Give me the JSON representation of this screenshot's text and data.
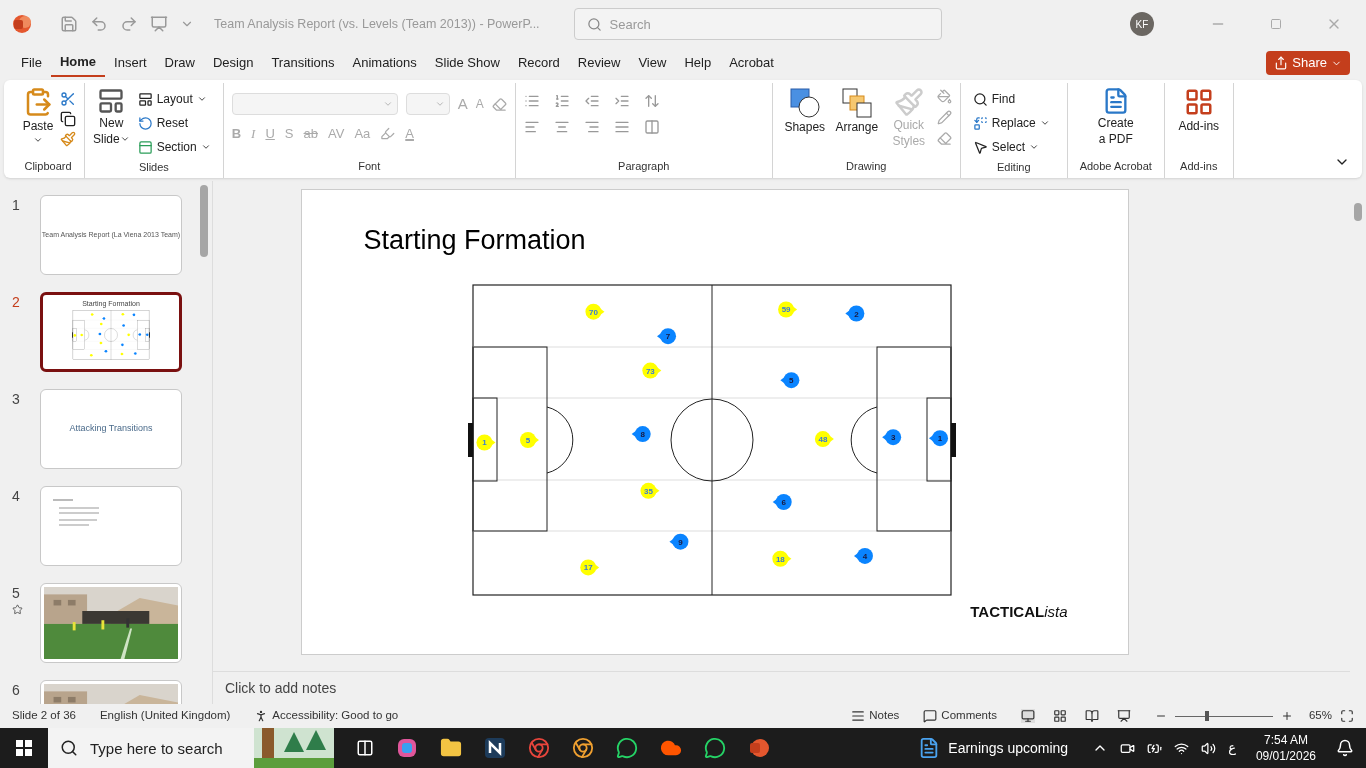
{
  "title_bar": {
    "title": "Team Analysis Report (vs. Levels (Team 2013))  -  PowerP...",
    "search_placeholder": "Search",
    "avatar": "KF"
  },
  "tabs": [
    {
      "label": "File",
      "selected": false
    },
    {
      "label": "Home",
      "selected": true
    },
    {
      "label": "Insert",
      "selected": false
    },
    {
      "label": "Draw",
      "selected": false
    },
    {
      "label": "Design",
      "selected": false
    },
    {
      "label": "Transitions",
      "selected": false
    },
    {
      "label": "Animations",
      "selected": false
    },
    {
      "label": "Slide Show",
      "selected": false
    },
    {
      "label": "Record",
      "selected": false
    },
    {
      "label": "Review",
      "selected": false
    },
    {
      "label": "View",
      "selected": false
    },
    {
      "label": "Help",
      "selected": false
    },
    {
      "label": "Acrobat",
      "selected": false
    }
  ],
  "share": "Share",
  "ribbon": {
    "clipboard": {
      "label": "Clipboard",
      "paste": "Paste"
    },
    "slides": {
      "label": "Slides",
      "new_slide": [
        "New",
        "Slide"
      ],
      "items": [
        "Layout",
        "Reset",
        "Section"
      ]
    },
    "font": {
      "label": "Font",
      "grow": "A",
      "shrink": "A",
      "buttons": [
        "B",
        "I",
        "U",
        "S",
        "ab",
        "AV",
        "Aa"
      ],
      "font_color_button": "A"
    },
    "paragraph": {
      "label": "Paragraph"
    },
    "drawing": {
      "label": "Drawing",
      "items": [
        {
          "label": "Shapes",
          "disabled": false
        },
        {
          "label": "Arrange",
          "disabled": false
        },
        {
          "label": "Quick Styles",
          "disabled": true
        }
      ]
    },
    "editing": {
      "label": "Editing",
      "items": [
        "Find",
        "Replace",
        "Select"
      ]
    },
    "acrobat": {
      "label": "Adobe Acrobat",
      "button": [
        "Create",
        "a PDF"
      ]
    },
    "addins": {
      "label": "Add-ins",
      "button": "Add-ins"
    }
  },
  "thumbnails": [
    {
      "number": "1",
      "selected": false,
      "starred": false,
      "kind": "title",
      "title": "Team Analysis Report (La Viena 2013 Team)"
    },
    {
      "number": "2",
      "selected": true,
      "starred": false,
      "kind": "formation",
      "title": "Starting Formation"
    },
    {
      "number": "3",
      "selected": false,
      "starred": false,
      "kind": "section",
      "title": "Attacking Transitions"
    },
    {
      "number": "4",
      "selected": false,
      "starred": false,
      "kind": "bullets"
    },
    {
      "number": "5",
      "selected": false,
      "starred": true,
      "kind": "picture"
    },
    {
      "number": "6",
      "selected": false,
      "starred": false,
      "kind": "picture"
    }
  ],
  "slide": {
    "title": "Starting Formation",
    "logo": {
      "main": "TACTICAL",
      "accent": "ista"
    },
    "players": [
      {
        "number": "70",
        "color": "#ffff00"
      },
      {
        "number": "73",
        "color": "#ffff00"
      },
      {
        "number": "1",
        "color": "#ffff00"
      },
      {
        "number": "5",
        "color": "#ffff00"
      },
      {
        "number": "35",
        "color": "#ffff00"
      },
      {
        "number": "17",
        "color": "#ffff00"
      },
      {
        "number": "59",
        "color": "#ffff00"
      },
      {
        "number": "48",
        "color": "#ffff00"
      },
      {
        "number": "18",
        "color": "#ffff00"
      },
      {
        "number": "7",
        "color": "#0a84ff"
      },
      {
        "number": "8",
        "color": "#0a84ff"
      },
      {
        "number": "9",
        "color": "#0a84ff"
      },
      {
        "number": "2",
        "color": "#0a84ff"
      },
      {
        "number": "5",
        "color": "#0a84ff"
      },
      {
        "number": "6",
        "color": "#0a84ff"
      },
      {
        "number": "3",
        "color": "#0a84ff"
      },
      {
        "number": "1",
        "color": "#0a84ff"
      },
      {
        "number": "4",
        "color": "#0a84ff"
      }
    ]
  },
  "notes_placeholder": "Click to add notes",
  "status_bar": {
    "slide": "Slide 2 of 36",
    "language": "English (United Kingdom)",
    "accessibility": "Accessibility: Good to go",
    "notes": "Notes",
    "comments": "Comments",
    "zoom": {
      "level": 0.31
    },
    "zoom_value": "65%"
  },
  "taskbar": {
    "search_placeholder": "Type here to search",
    "weather": "Earnings upcoming",
    "keyboard": "ع",
    "time": "7:54 AM",
    "date": "09/01/2026"
  }
}
